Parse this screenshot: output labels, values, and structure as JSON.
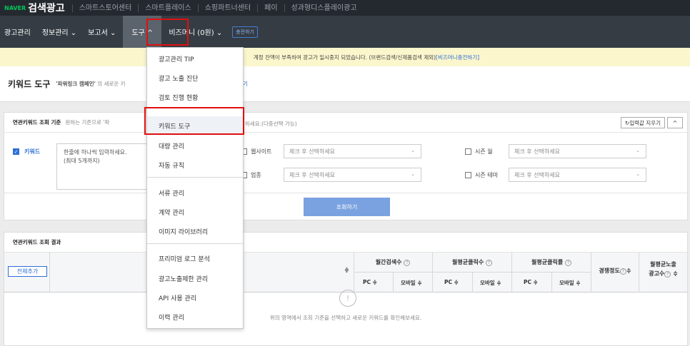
{
  "topbar": {
    "naver": "NAVER",
    "brand": "검색광고",
    "links": [
      "스마트스토어센터",
      "스마트플레이스",
      "쇼핑파트너센터",
      "페이",
      "성과형디스플레이광고"
    ]
  },
  "nav": {
    "items": [
      "광고관리",
      "정보관리 ⌄",
      "보고서 ⌄",
      "도구 ^",
      "비즈머니 (0원) ⌄"
    ],
    "charge": "충전하기"
  },
  "notice": {
    "text": "계정 잔액이 부족하여 광고가 일시중지 되었습니다. (브랜드검색/신제품검색 제외)",
    "link": "[비즈머니충전하기]"
  },
  "page": {
    "title": "키워드 도구",
    "subtitle_prefix": "'파워링크 캠페인'",
    "subtitle_rest": " 의 새로운 키",
    "link_fragment": "기"
  },
  "criteria": {
    "title": "연관키워드 조회 기준",
    "desc_left": "원하는 기준으로 '파",
    "desc_right": "회하세요.(다중선택 가능)",
    "reset_label": "↻입력값 지우기",
    "collapse_label": "^",
    "keyword_label": "키워드",
    "keyword_placeholder_1": "한줄에 하나씩 입력하세요.",
    "keyword_placeholder_2": "(최대 5개까지)",
    "website_label": "웹사이트",
    "industry_label": "업종",
    "season_month_label": "시즌 월",
    "season_theme_label": "시즌 테마",
    "select_placeholder": "체크 후 선택하세요",
    "search_button": "조회하기"
  },
  "results": {
    "title": "연관키워드 조회 결과",
    "add_all": "전체추가",
    "sort_icon": "≑",
    "col_monthly_search": "월간검색수",
    "col_avg_clicks": "월평균클릭수",
    "col_avg_ctr": "월평균클릭률",
    "col_competition": "경쟁정도",
    "col_avg_impressions_1": "월평균노출",
    "col_avg_impressions_2": "광고수",
    "pc": "PC",
    "mobile": "모바일",
    "empty_icon": "!",
    "empty_text": "위의 영역에서 조회 기준을 선택하고 새로운 키워드를 확인해보세요."
  },
  "dropdown": {
    "items": [
      "광고관리 TIP",
      "광고 노출 진단",
      "검토 진행 현황",
      "키워드 도구",
      "대량 관리",
      "자동 규칙",
      "서류 관리",
      "계약 관리",
      "이미지 라이브러리",
      "프리미엄 로그 분석",
      "광고노출제한 관리",
      "API 사용 관리",
      "이력 관리"
    ]
  },
  "colors": {
    "accent": "#2d6fd6",
    "highlight_border": "#e0100e",
    "navbar": "#353c44",
    "topbar": "#24292f",
    "notice_bg": "#fbf6cc"
  }
}
